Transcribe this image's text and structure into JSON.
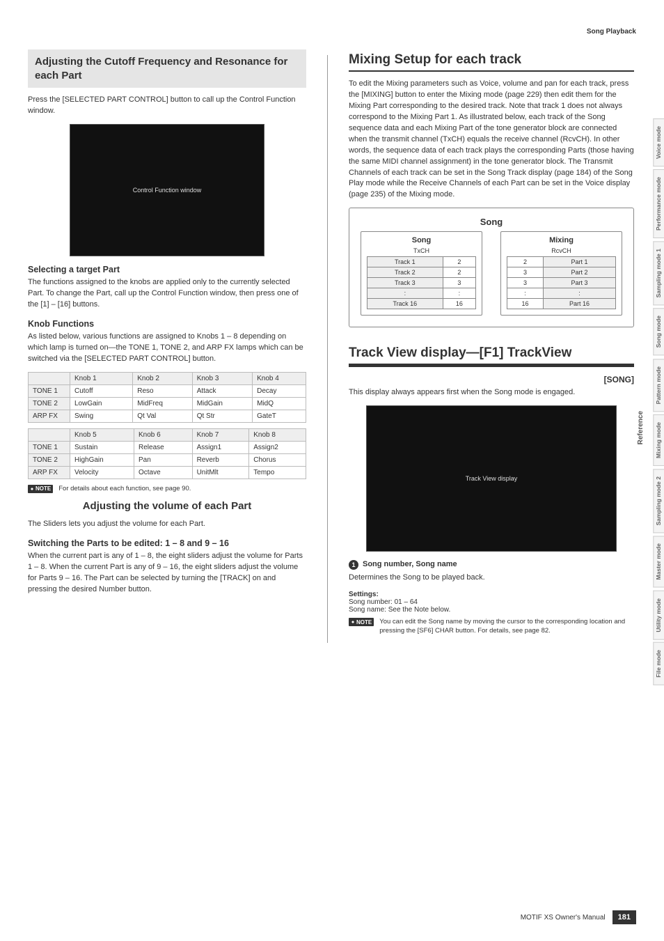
{
  "breadcrumb": "Song Playback",
  "left": {
    "sec1_title": "Adjusting the Cutoff Frequency and Resonance for each Part",
    "sec1_intro": "Press the [SELECTED PART CONTROL] button to call up the Control Function window.",
    "img1_label": "Control Function window",
    "sec1_h2a": "Selecting a target Part",
    "sec1_p2": "The functions assigned to the knobs are applied only to the currently selected Part. To change the Part, call up the Control Function window, then press one of the [1] – [16] buttons.",
    "sec1_h2b": "Knob Functions",
    "sec1_p3": "As listed below, various functions are assigned to Knobs 1 – 8 depending on which lamp is turned on—the TONE 1, TONE 2, and ARP FX lamps which can be switched via the [SELECTED PART CONTROL] button.",
    "knob_top_headers": [
      "Knob 1",
      "Knob 2",
      "Knob 3",
      "Knob 4"
    ],
    "knob_top_rows": [
      {
        "hdr": "TONE 1",
        "cells": [
          "Cutoff",
          "Reso",
          "Attack",
          "Decay"
        ]
      },
      {
        "hdr": "TONE 2",
        "cells": [
          "LowGain",
          "MidFreq",
          "MidGain",
          "MidQ"
        ]
      },
      {
        "hdr": "ARP FX",
        "cells": [
          "Swing",
          "Qt Val",
          "Qt Str",
          "GateT"
        ]
      }
    ],
    "knob_bot_headers": [
      "Knob 5",
      "Knob 6",
      "Knob 7",
      "Knob 8"
    ],
    "knob_bot_rows": [
      {
        "hdr": "TONE 1",
        "cells": [
          "Sustain",
          "Release",
          "Assign1",
          "Assign2"
        ]
      },
      {
        "hdr": "TONE 2",
        "cells": [
          "HighGain",
          "Pan",
          "Reverb",
          "Chorus"
        ]
      },
      {
        "hdr": "ARP FX",
        "cells": [
          "Velocity",
          "Octave",
          "UnitMlt",
          "Tempo"
        ]
      }
    ],
    "note1_badge": "NOTE",
    "note1_text": "For details about each function, see page 90.",
    "sec2_title": "Adjusting the volume of each Part",
    "sec2_intro": "The Sliders lets you adjust the volume for each Part.",
    "sec2_h2": "Switching the Parts to be edited: 1 – 8 and 9 – 16",
    "sec2_p2": "When the current part is any of 1 – 8, the eight sliders adjust the volume for Parts 1 – 8. When the current Part is any of 9 – 16, the eight sliders adjust the volume for Parts 9 – 16. The Part can be selected by turning the [TRACK] on and pressing the desired Number button."
  },
  "right": {
    "h1a": "Mixing Setup for each track",
    "p1": "To edit the Mixing parameters such as Voice, volume and pan for each track, press the [MIXING] button to enter the Mixing mode (page 229) then edit them for the Mixing Part corresponding to the desired track. Note that track 1 does not always correspond to the Mixing Part 1. As illustrated below, each track of the Song sequence data and each Mixing Part of the tone generator block are connected when the transmit channel (TxCH) equals the receive channel (RcvCH). In other words, the sequence data of each track plays the corresponding Parts (those having the same MIDI channel assignment) in the tone generator block. The Transmit Channels of each track can be set in the Song Track display (page 184) of the Song Play mode while the Receive Channels of each Part can be set in the Voice display (page 235) of the Mixing mode.",
    "sm": {
      "title": "Song",
      "left_box": "Song",
      "left_sub": "TxCH",
      "right_box": "Mixing",
      "right_sub": "RcvCH",
      "rows_left": [
        [
          "Track 1",
          "2"
        ],
        [
          "Track 2",
          "2"
        ],
        [
          "Track 3",
          "3"
        ],
        [
          ":",
          ":"
        ],
        [
          "Track 16",
          "16"
        ]
      ],
      "rows_right": [
        [
          "2",
          "Part 1"
        ],
        [
          "3",
          "Part 2"
        ],
        [
          "3",
          "Part 3"
        ],
        [
          ":",
          ":"
        ],
        [
          "16",
          "Part 16"
        ]
      ]
    },
    "h1b": "Track View display—[F1] TrackView",
    "tag": "[SONG]",
    "p2": "This display always appears first when the Song mode is engaged.",
    "img2_label": "Track View display",
    "callout_num": "1",
    "callout_title": "Song number, Song name",
    "callout_desc": "Determines the Song to be played back.",
    "settings_label": "Settings:",
    "settings_line1a": "Song number: ",
    "settings_line1b": "01 – 64",
    "settings_line2a": "Song name: ",
    "settings_line2b": "See the Note below.",
    "note2_badge": "NOTE",
    "note2_text": "You can edit the Song name by moving the cursor to the corresponding location and pressing the [SF6] CHAR button. For details, see page 82."
  },
  "sidetabs": [
    "Voice mode",
    "Performance mode",
    "Sampling mode 1",
    "Song mode",
    "Pattern mode",
    "Mixing mode",
    "Sampling mode 2",
    "Master mode",
    "Utility mode",
    "File mode"
  ],
  "reference_tab": "Reference",
  "footer_text": "MOTIF XS Owner's Manual",
  "page_number": "181"
}
